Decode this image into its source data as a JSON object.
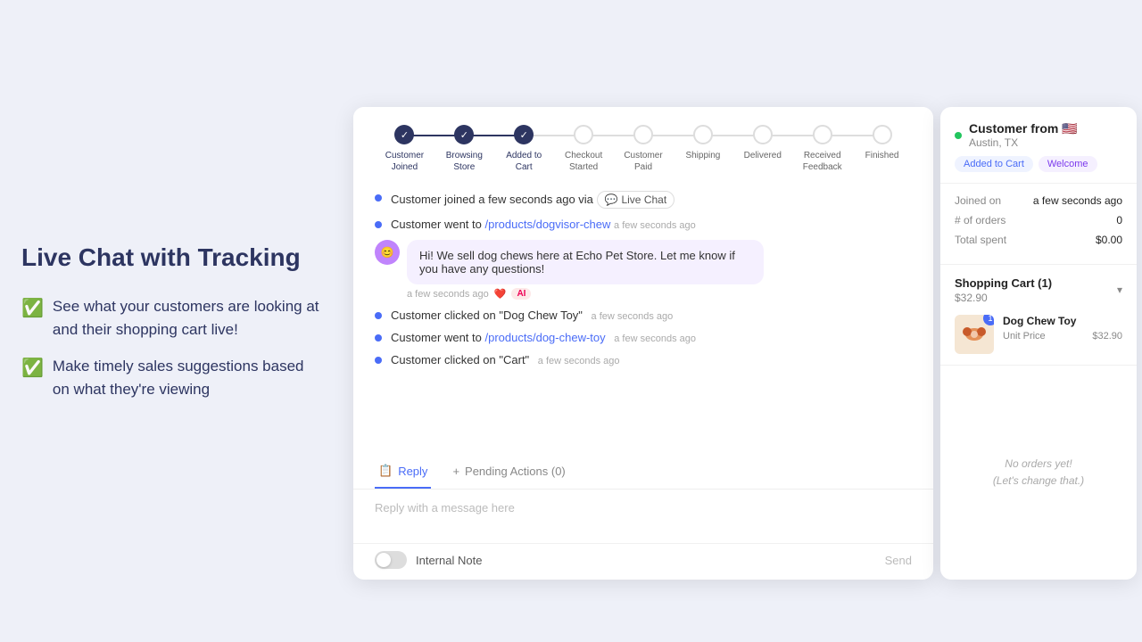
{
  "left": {
    "title": "Live Chat with Tracking",
    "features": [
      "See what your customers are looking at and their shopping cart live!",
      "Make timely sales suggestions based on what they're viewing"
    ]
  },
  "progress": {
    "steps": [
      {
        "label": "Customer\nJoined",
        "state": "completed"
      },
      {
        "label": "Browsing\nStore",
        "state": "completed"
      },
      {
        "label": "Added to\nCart",
        "state": "completed"
      },
      {
        "label": "Checkout\nStarted",
        "state": "inactive"
      },
      {
        "label": "Customer\nPaid",
        "state": "inactive"
      },
      {
        "label": "Shipping",
        "state": "inactive"
      },
      {
        "label": "Delivered",
        "state": "inactive"
      },
      {
        "label": "Received\nFeedback",
        "state": "inactive"
      },
      {
        "label": "Finished",
        "state": "inactive"
      }
    ]
  },
  "activity": [
    {
      "type": "event",
      "text": "Customer joined a few seconds ago via",
      "link": null,
      "suffix": "Live Chat",
      "time": ""
    },
    {
      "type": "event",
      "text": "Customer went to",
      "link": "/products/dogvisor-chew",
      "suffix": "",
      "time": "a few seconds ago"
    },
    {
      "type": "message",
      "avatar": "😊",
      "text": "Hi! We sell dog chews here at Echo Pet Store. Let me know if you have any questions!",
      "time": "a few seconds ago",
      "ai": "AI"
    },
    {
      "type": "event",
      "text": "Customer clicked on \"Dog Chew Toy\"",
      "link": null,
      "suffix": "",
      "time": "a few seconds ago"
    },
    {
      "type": "event",
      "text": "Customer went to",
      "link": "/products/dog-chew-toy",
      "suffix": "",
      "time": "a few seconds ago"
    },
    {
      "type": "event",
      "text": "Customer clicked on \"Cart\"",
      "link": null,
      "suffix": "",
      "time": "a few seconds ago"
    }
  ],
  "tabs": [
    {
      "label": "Reply",
      "icon": "📋",
      "active": true,
      "id": "reply"
    },
    {
      "label": "Pending Actions (0)",
      "icon": "+",
      "active": false,
      "id": "pending"
    }
  ],
  "reply": {
    "placeholder": "Reply with a message here",
    "toggle_label": "Internal Note",
    "send_label": "Send"
  },
  "sidebar": {
    "customer_name": "Customer from 🇺🇸",
    "customer_location": "Austin, TX",
    "badges": [
      {
        "label": "Added to Cart",
        "type": "blue"
      },
      {
        "label": "Welcome",
        "type": "purple"
      }
    ],
    "stats": [
      {
        "label": "Joined on",
        "value": "a few seconds ago"
      },
      {
        "label": "# of orders",
        "value": "0"
      },
      {
        "label": "Total spent",
        "value": "$0.00"
      }
    ],
    "cart": {
      "title": "Shopping Cart (1)",
      "total": "$32.90",
      "items": [
        {
          "name": "Dog Chew Toy",
          "unit_price_label": "Unit Price",
          "unit_price": "$32.90",
          "qty": "1"
        }
      ]
    },
    "orders": {
      "empty_line1": "No orders yet!",
      "empty_line2": "(Let's change that.)"
    }
  }
}
